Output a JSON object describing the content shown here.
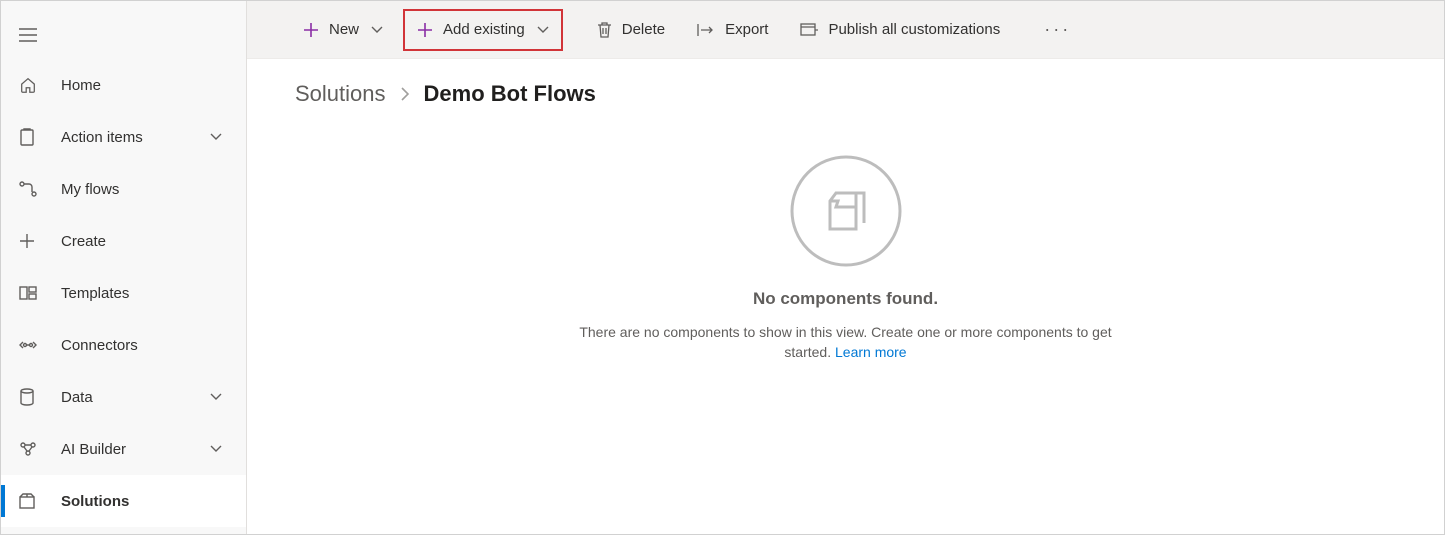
{
  "sidebar": {
    "items": [
      {
        "label": "Home",
        "icon": "home",
        "expandable": false,
        "selected": false
      },
      {
        "label": "Action items",
        "icon": "clipboard",
        "expandable": true,
        "selected": false
      },
      {
        "label": "My flows",
        "icon": "flow",
        "expandable": false,
        "selected": false
      },
      {
        "label": "Create",
        "icon": "plus",
        "expandable": false,
        "selected": false
      },
      {
        "label": "Templates",
        "icon": "templates",
        "expandable": false,
        "selected": false
      },
      {
        "label": "Connectors",
        "icon": "connectors",
        "expandable": false,
        "selected": false
      },
      {
        "label": "Data",
        "icon": "data",
        "expandable": true,
        "selected": false
      },
      {
        "label": "AI Builder",
        "icon": "ai",
        "expandable": true,
        "selected": false
      },
      {
        "label": "Solutions",
        "icon": "solutions",
        "expandable": false,
        "selected": true
      }
    ]
  },
  "toolbar": {
    "new_label": "New",
    "add_existing_label": "Add existing",
    "delete_label": "Delete",
    "export_label": "Export",
    "publish_label": "Publish all customizations"
  },
  "breadcrumb": {
    "root": "Solutions",
    "current": "Demo Bot Flows"
  },
  "empty": {
    "title": "No components found.",
    "subtitle": "There are no components to show in this view. Create one or more components to get started.",
    "link_text": "Learn more"
  },
  "colors": {
    "accent_purple": "#8a2da5",
    "link_blue": "#0078d4",
    "highlight_red": "#d13438"
  }
}
